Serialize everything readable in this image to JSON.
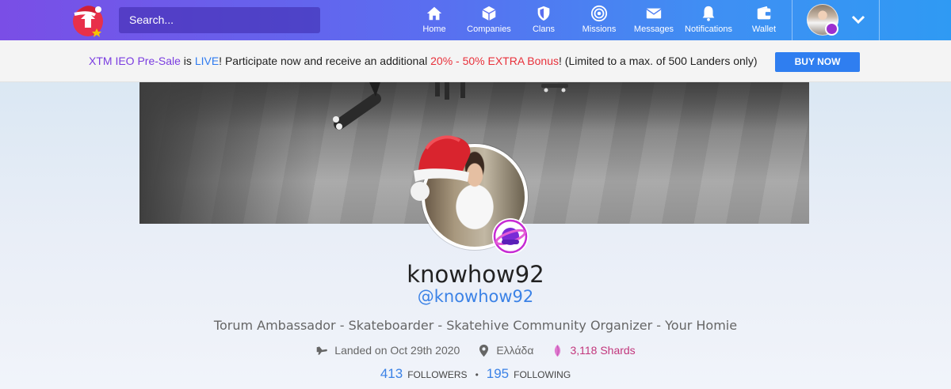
{
  "navbar": {
    "search_placeholder": "Search...",
    "items": [
      {
        "label": "Home",
        "icon": "home-icon"
      },
      {
        "label": "Companies",
        "icon": "cube-icon"
      },
      {
        "label": "Clans",
        "icon": "shield-icon"
      },
      {
        "label": "Missions",
        "icon": "target-icon"
      },
      {
        "label": "Messages",
        "icon": "envelope-icon"
      },
      {
        "label": "Notifications",
        "icon": "bell-icon"
      },
      {
        "label": "Wallet",
        "icon": "wallet-icon"
      }
    ],
    "colors": {
      "gradient_start": "#7a4ee6",
      "gradient_end": "#2f9af3"
    }
  },
  "promo": {
    "part1": "XTM IEO Pre-Sale",
    "part2": " is ",
    "part3": "LIVE",
    "part4": "! Participate now and receive an additional ",
    "part5": "20% - 50% EXTRA Bonus",
    "part6": "! (Limited to a max. of 500 Landers only)",
    "button_label": "BUY NOW",
    "colors": {
      "purple": "#7a3ce0",
      "blue": "#2f7bf0",
      "red": "#e8303a",
      "button": "#2f7ef0"
    }
  },
  "profile": {
    "username": "knowhow92",
    "handle": "@knowhow92",
    "bio": "Torum Ambassador - Skateboarder - Skatehive Community Organizer - Your Homie",
    "landed": "Landed on Oct 29th 2020",
    "location": "Ελλάδα",
    "shards": "3,118 Shards",
    "followers_count": "413",
    "followers_label": "FOLLOWERS",
    "following_count": "195",
    "following_label": "FOLLOWING"
  }
}
